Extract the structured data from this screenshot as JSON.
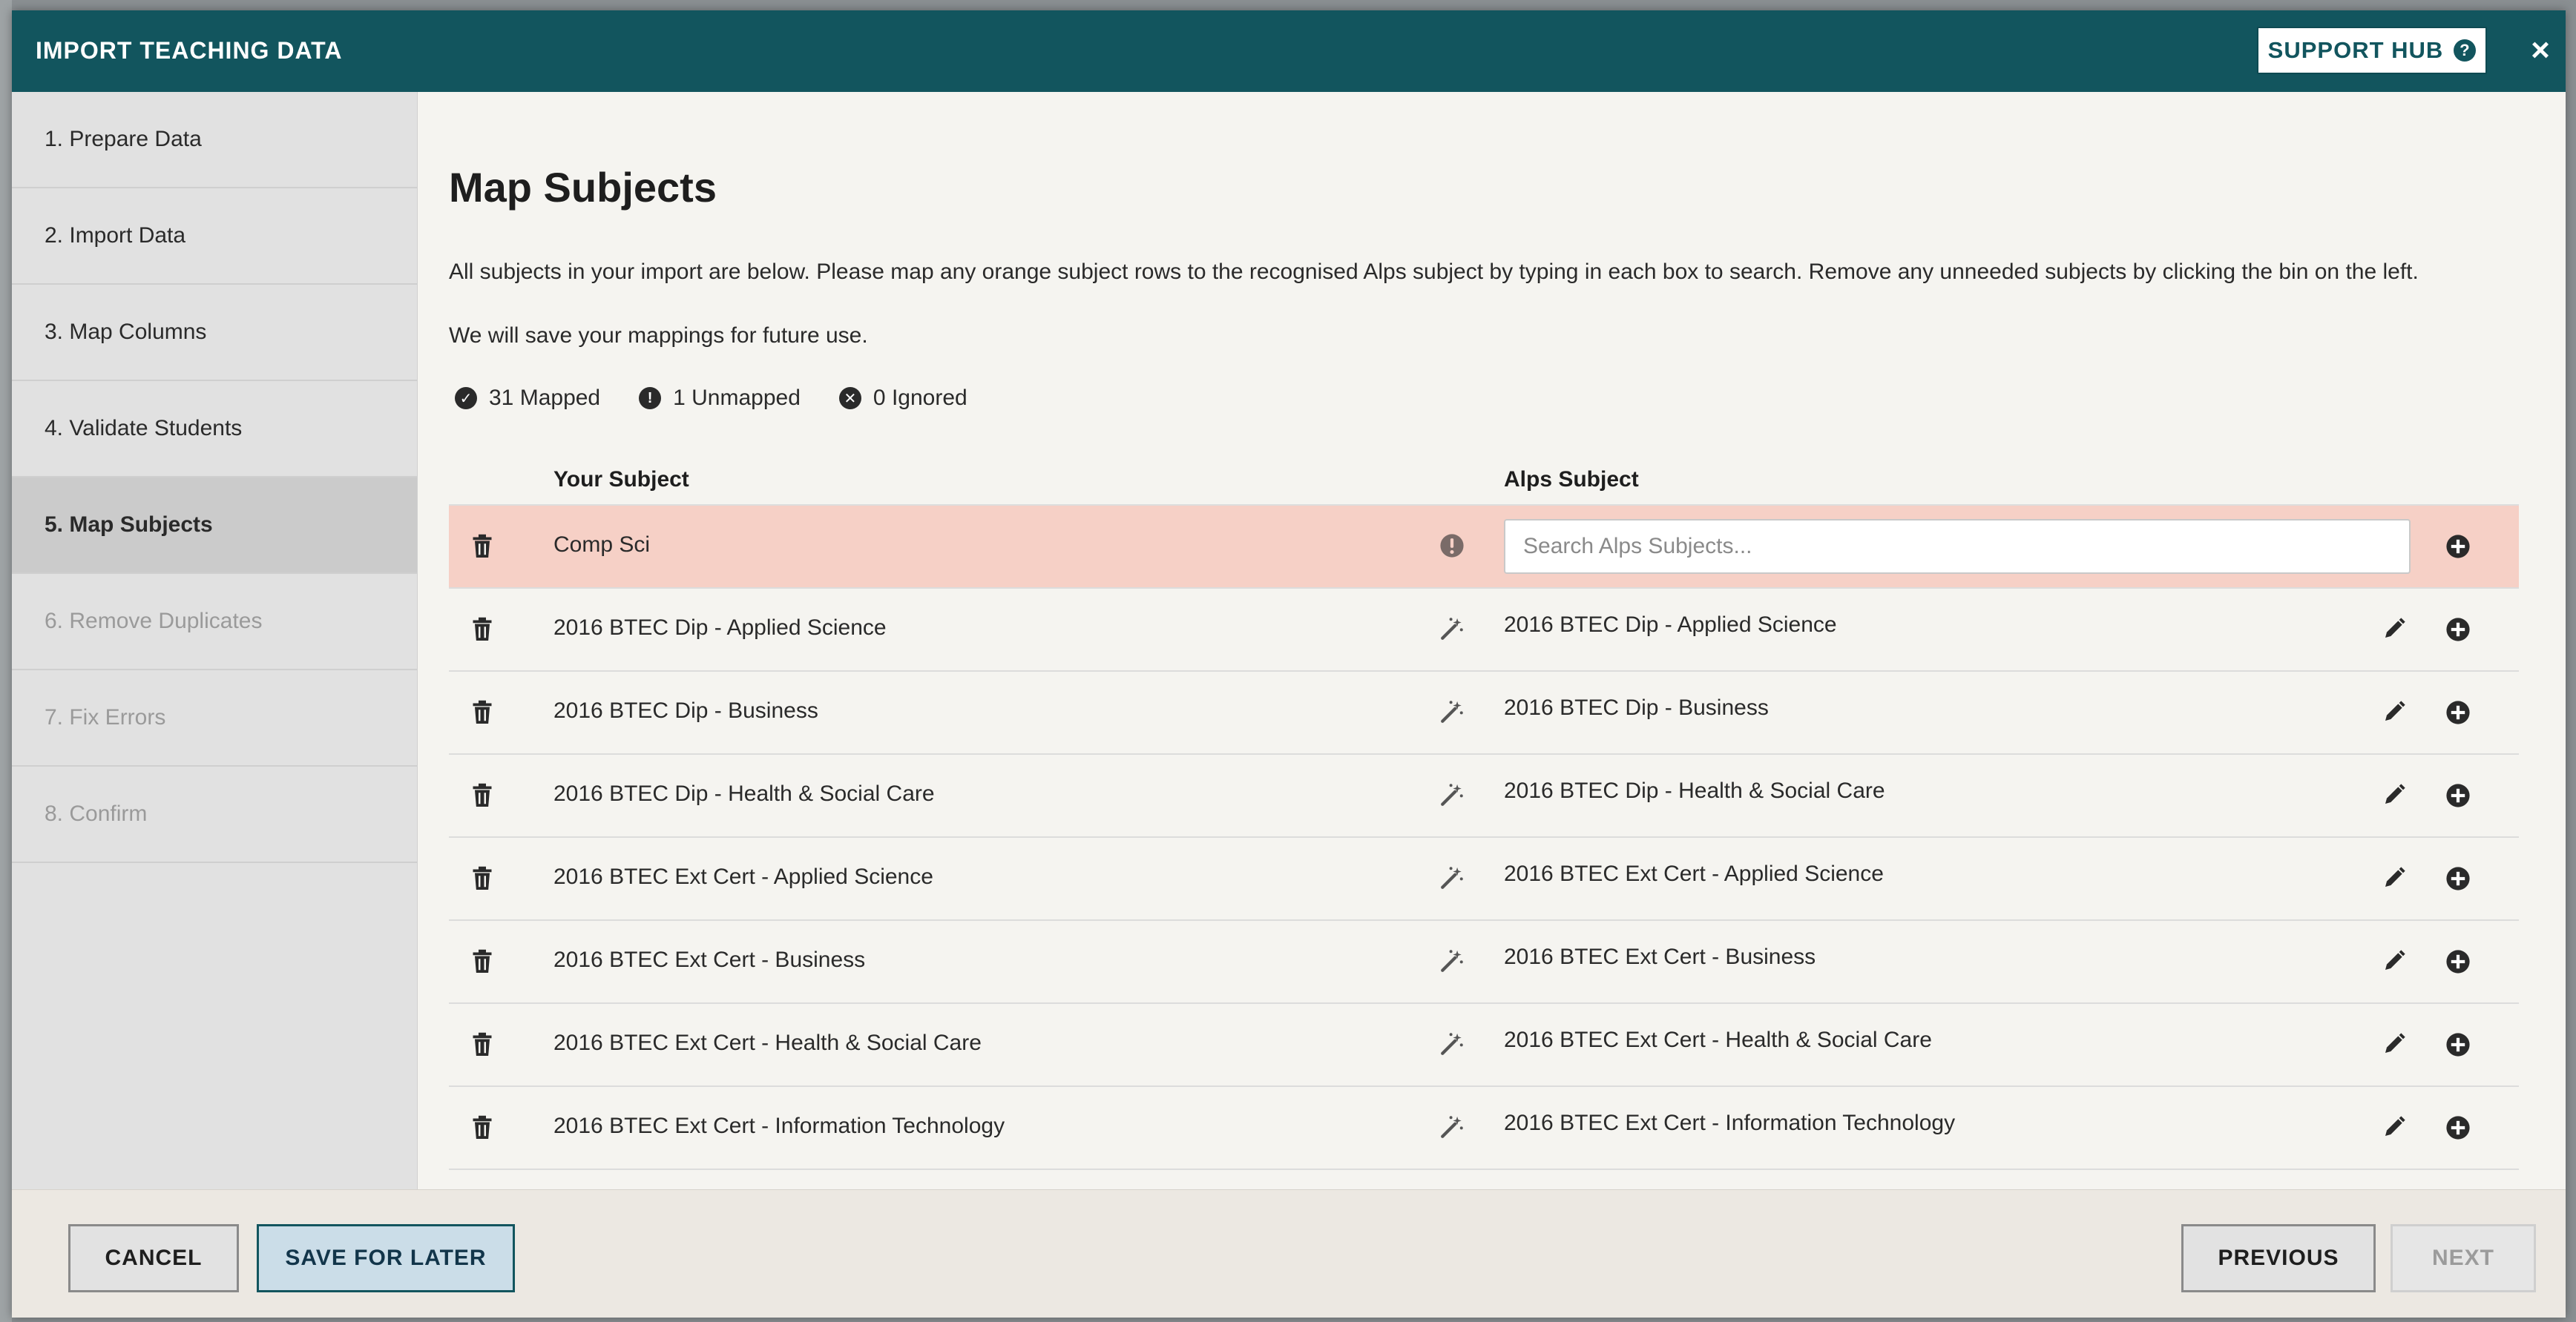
{
  "header": {
    "title": "IMPORT TEACHING DATA",
    "support_label": "SUPPORT HUB",
    "support_icon": "question-circle-icon",
    "close_icon": "close-icon",
    "close_glyph": "×"
  },
  "sidebar": {
    "steps": [
      {
        "label": "1. Prepare Data",
        "state": "done"
      },
      {
        "label": "2. Import Data",
        "state": "done"
      },
      {
        "label": "3. Map Columns",
        "state": "done"
      },
      {
        "label": "4. Validate Students",
        "state": "done"
      },
      {
        "label": "5. Map Subjects",
        "state": "active"
      },
      {
        "label": "6. Remove Duplicates",
        "state": "disabled"
      },
      {
        "label": "7. Fix Errors",
        "state": "disabled"
      },
      {
        "label": "8. Confirm",
        "state": "disabled"
      }
    ]
  },
  "main": {
    "title": "Map Subjects",
    "instructions": "All subjects in your import are below. Please map any orange subject rows to the recognised Alps subject by typing in each box to search. Remove any unneeded subjects by clicking the bin on the left.",
    "note": "We will save your mappings for future use.",
    "summary": {
      "mapped": "31 Mapped",
      "unmapped": "1 Unmapped",
      "ignored": "0 Ignored"
    },
    "table": {
      "col_your": "Your Subject",
      "col_alps": "Alps Subject",
      "search_placeholder": "Search Alps Subjects...",
      "rows": [
        {
          "your": "Comp Sci",
          "alps": "",
          "status": "unmapped"
        },
        {
          "your": "2016 BTEC Dip - Applied Science",
          "alps": "2016 BTEC Dip - Applied Science",
          "status": "auto"
        },
        {
          "your": "2016 BTEC Dip - Business",
          "alps": "2016 BTEC Dip - Business",
          "status": "auto"
        },
        {
          "your": "2016 BTEC Dip - Health & Social Care",
          "alps": "2016 BTEC Dip - Health & Social Care",
          "status": "auto"
        },
        {
          "your": "2016 BTEC Ext Cert - Applied Science",
          "alps": "2016 BTEC Ext Cert - Applied Science",
          "status": "auto"
        },
        {
          "your": "2016 BTEC Ext Cert - Business",
          "alps": "2016 BTEC Ext Cert - Business",
          "status": "auto"
        },
        {
          "your": "2016 BTEC Ext Cert - Health & Social Care",
          "alps": "2016 BTEC Ext Cert - Health & Social Care",
          "status": "auto"
        },
        {
          "your": "2016 BTEC Ext Cert - Information Technology",
          "alps": "2016 BTEC Ext Cert - Information Technology",
          "status": "auto"
        }
      ]
    }
  },
  "footer": {
    "cancel": "CANCEL",
    "save_later": "SAVE FOR LATER",
    "previous": "PREVIOUS",
    "next": "NEXT"
  },
  "colors": {
    "header": "#12555e",
    "unmapped_row": "#f6d0c6",
    "sidebar": "#e1e1e1",
    "sidebar_active": "#cbcbcb"
  }
}
